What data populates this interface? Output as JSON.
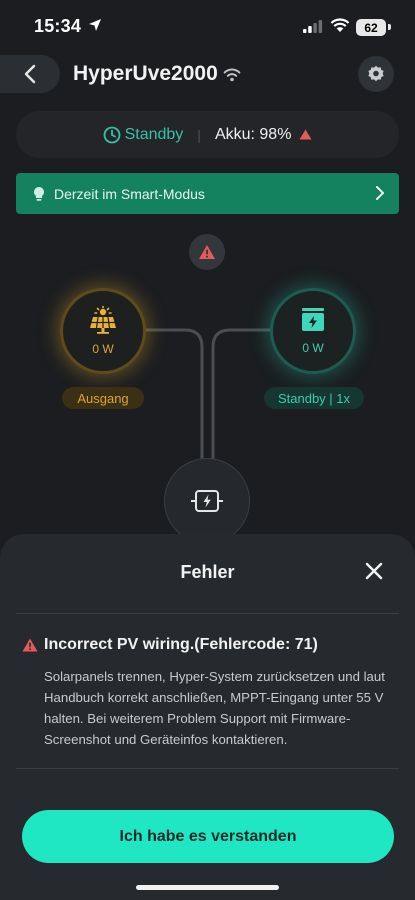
{
  "status_bar": {
    "time": "15:34",
    "battery": "62"
  },
  "header": {
    "title": "HyperUve2000"
  },
  "status_card": {
    "mode": "Standby",
    "battery_label": "Akku: 98%"
  },
  "smart_banner": {
    "text": "Derzeit im Smart-Modus"
  },
  "energy_flow": {
    "solar": {
      "power": "0 W",
      "label": "Ausgang"
    },
    "battery": {
      "power": "0 W",
      "label": "Standby | 1x"
    }
  },
  "error_sheet": {
    "title": "Fehler",
    "heading": "Incorrect PV wiring.(Fehlercode: 71)",
    "body": "Solarpanels trennen, Hyper-System zurücksetzen und laut Handbuch korrekt anschließen, MPPT-Eingang unter 55 V halten. Bei weiterem Problem Support mit Firmware-Screenshot und Geräteinfos kontaktieren.",
    "confirm_label": "Ich habe es verstanden"
  },
  "colors": {
    "background": "#1b1d20",
    "accent_teal": "#1fe6c3",
    "standby_green": "#35c3a8",
    "solar_gold": "#d9a72c",
    "warning_red": "#e35a5a",
    "banner_green": "#14815f"
  },
  "icons": {
    "location": "location-arrow-icon",
    "signal": "cellular-signal-icon",
    "wifi": "wifi-icon",
    "back": "chevron-left-icon",
    "device_wifi": "wifi-icon",
    "settings": "gear-icon",
    "clock": "clock-icon",
    "warning": "warning-triangle-icon",
    "bulb": "lightbulb-icon",
    "chevron": "chevron-right-icon",
    "solar": "solar-panel-icon",
    "battery": "battery-bolt-icon",
    "hub": "inverter-bolt-icon",
    "close": "close-icon"
  }
}
